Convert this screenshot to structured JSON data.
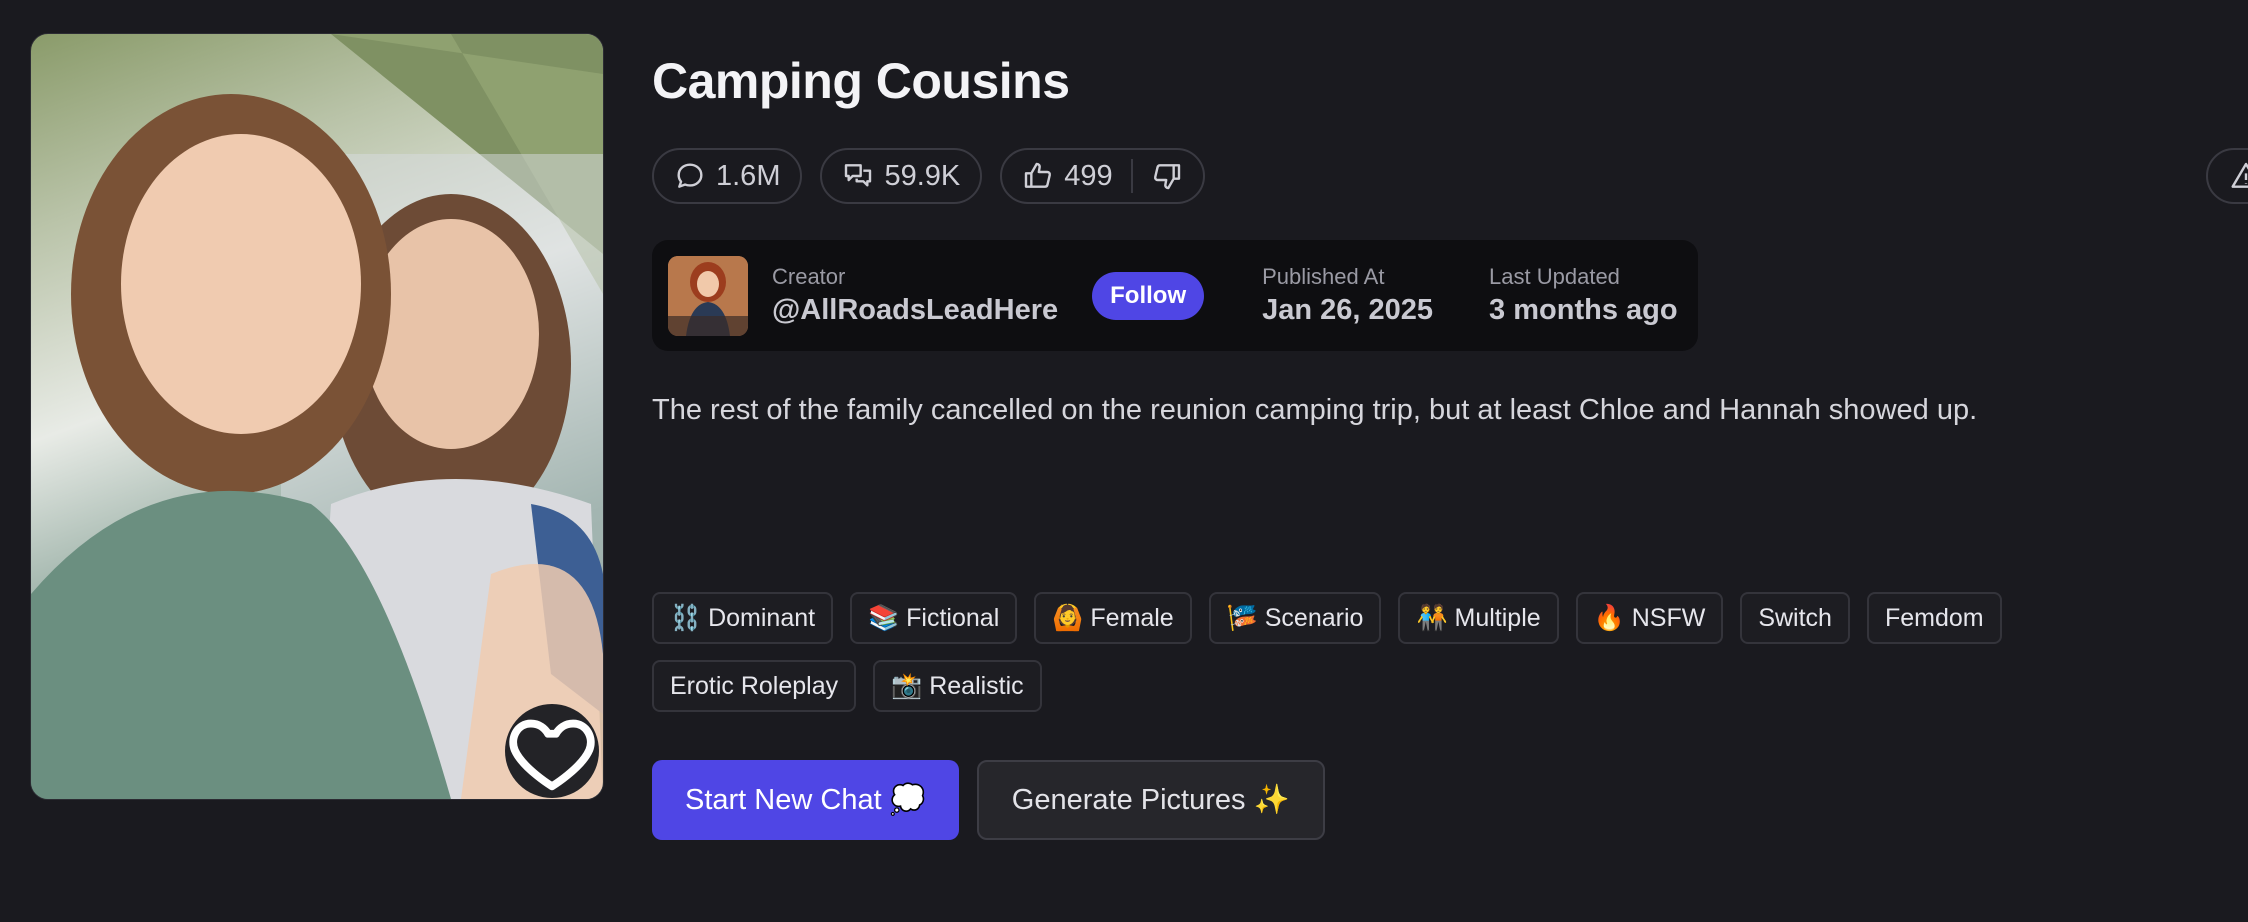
{
  "character": {
    "title": "Camping Cousins",
    "description": "The rest of the family cancelled on the reunion camping trip, but at least Chloe and Hannah showed up.",
    "cover_icon": "favorite-heart-icon"
  },
  "stats": {
    "messages": "1.6M",
    "chats": "59.9K",
    "likes": "499"
  },
  "creator": {
    "label": "Creator",
    "handle": "@AllRoadsLeadHere",
    "follow_label": "Follow",
    "published_label": "Published At",
    "published_value": "Jan 26, 2025",
    "updated_label": "Last Updated",
    "updated_value": "3 months ago"
  },
  "tags": [
    "⛓️ Dominant",
    "📚 Fictional",
    "🙆 Female",
    "🎏 Scenario",
    "🧑‍🤝‍🧑 Multiple",
    "🔥 NSFW",
    "Switch",
    "Femdom",
    "Erotic Roleplay",
    "📸 Realistic"
  ],
  "actions": {
    "start_chat": "Start New Chat 💭",
    "generate_pictures": "Generate Pictures ✨"
  },
  "colors": {
    "background": "#1a1a1f",
    "accent": "#4f46e5",
    "card": "#0e0e11"
  }
}
